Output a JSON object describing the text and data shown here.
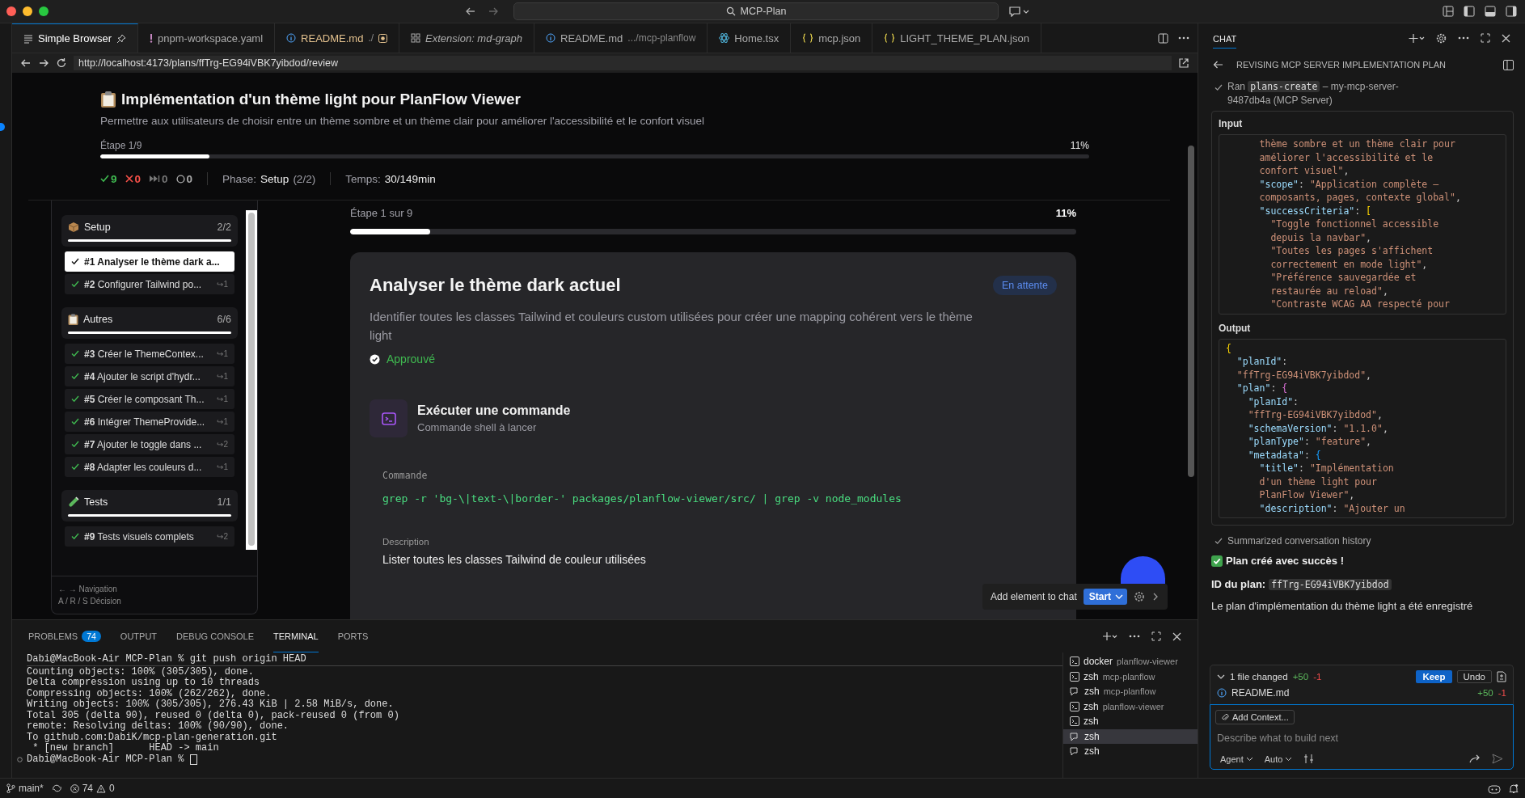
{
  "window": {
    "search": "MCP-Plan"
  },
  "editor_tabs": [
    {
      "label": "Simple Browser",
      "kind": "browser",
      "selected": true,
      "modified": false,
      "preview": false,
      "pinned": true
    },
    {
      "label": "pnpm-workspace.yaml",
      "kind": "yaml",
      "selected": false,
      "modified": false,
      "preview": false,
      "pinned": false
    },
    {
      "label": "README.md",
      "detail": "./",
      "kind": "info",
      "selected": false,
      "modified": true,
      "preview": false,
      "pinned": false
    },
    {
      "label": "Extension: md-graph",
      "kind": "extension",
      "selected": false,
      "modified": false,
      "preview": true,
      "pinned": false
    },
    {
      "label": "README.md",
      "detail": ".../mcp-planflow",
      "kind": "info",
      "selected": false,
      "modified": false,
      "preview": false,
      "pinned": false
    },
    {
      "label": "Home.tsx",
      "kind": "react",
      "selected": false,
      "modified": false,
      "preview": false,
      "pinned": false
    },
    {
      "label": "mcp.json",
      "kind": "json",
      "selected": false,
      "modified": false,
      "preview": false,
      "pinned": false
    },
    {
      "label": "LIGHT_THEME_PLAN.json",
      "kind": "json",
      "selected": false,
      "modified": false,
      "preview": false,
      "pinned": false
    }
  ],
  "browser": {
    "url": "http://localhost:4173/plans/ffTrg-EG94iVBK7yibdod/review"
  },
  "plan": {
    "title": "Implémentation d'un thème light pour PlanFlow Viewer",
    "description": "Permettre aux utilisateurs de choisir entre un thème sombre et un thème clair pour améliorer l'accessibilité et le confort visuel",
    "step_label": "Étape 1/9",
    "percent": "11%",
    "level": 0.11,
    "stats": [
      {
        "kind": "done",
        "text": "9"
      },
      {
        "kind": "failed",
        "text": "0"
      },
      {
        "kind": "skipped",
        "text": "0"
      },
      {
        "kind": "pending",
        "text": "0"
      }
    ],
    "phase_label": "Phase:",
    "phase": "Setup",
    "phase_count": "(2/2)",
    "time_label": "Temps:",
    "time": "30/149min"
  },
  "sidebar": {
    "groups": [
      {
        "kind": "package",
        "title": "Setup",
        "count": "2/2",
        "level": 1,
        "steps": [
          {
            "label": "**#1** Analyser le thème dark a...",
            "selected": true,
            "done": true
          },
          {
            "label": "**#2** Configurer Tailwind po...",
            "deps": "↪1",
            "selected": false,
            "done": true
          }
        ]
      },
      {
        "kind": "clipboard",
        "title": "Autres",
        "count": "6/6",
        "level": 1,
        "steps": [
          {
            "label": "**#3** Créer le ThemeContex...",
            "deps": "↪1",
            "selected": false,
            "done": true
          },
          {
            "label": "**#4** Ajouter le script d'hydr...",
            "deps": "↪1",
            "selected": false,
            "done": true
          },
          {
            "label": "**#5** Créer le composant Th...",
            "deps": "↪1",
            "selected": false,
            "done": true
          },
          {
            "label": "**#6** Intégrer ThemeProvide...",
            "deps": "↪1",
            "selected": false,
            "done": true
          },
          {
            "label": "**#7** Ajouter le toggle dans ...",
            "deps": "↪2",
            "selected": false,
            "done": true
          },
          {
            "label": "**#8** Adapter les couleurs d...",
            "deps": "↪1",
            "selected": false,
            "done": true
          }
        ]
      },
      {
        "kind": "test",
        "title": "Tests",
        "count": "1/1",
        "level": 1,
        "steps": [
          {
            "label": "**#9** Tests visuels complets",
            "deps": "↪2",
            "selected": false,
            "done": true
          }
        ]
      }
    ],
    "footer": [
      "← → Navigation",
      "A / R / S Décision"
    ]
  },
  "step": {
    "label": "Étape 1 sur 9",
    "percent": "11%",
    "level": 0.11,
    "title": "Analyser le thème dark actuel",
    "badge": "En attente",
    "description": "Identifier toutes les classes Tailwind et couleurs custom utilisées pour créer une mapping cohérent vers le thème light",
    "status": {
      "text": "Approuvé",
      "approved": true
    },
    "action": {
      "title": "Exécuter une commande",
      "subtitle": "Commande shell à lancer"
    },
    "fields": [
      {
        "kind": "code",
        "label": "Commande",
        "value": "grep -r 'bg-\\|text-\\|border-' packages/planflow-viewer/src/ | grep -v node_modules"
      },
      {
        "kind": "text",
        "label": "Description",
        "value": "Lister toutes les classes Tailwind de couleur utilisées"
      }
    ]
  },
  "element_picker": {
    "label": "Add element to chat",
    "button": "Start"
  },
  "panel": {
    "tabs": [
      {
        "label": "PROBLEMS",
        "badge": "74",
        "selected": false
      },
      {
        "label": "OUTPUT",
        "selected": false
      },
      {
        "label": "DEBUG CONSOLE",
        "selected": false
      },
      {
        "label": "TERMINAL",
        "selected": true
      },
      {
        "label": "PORTS",
        "selected": false
      }
    ],
    "terminal_lines": [
      "Dabi@MacBook-Air MCP-Plan % git push origin HEAD",
      "Counting objects: 100% (305/305), done.",
      "Delta compression using up to 10 threads",
      "Compressing objects: 100% (262/262), done.",
      "Writing objects: 100% (305/305), 276.43 KiB | 2.58 MiB/s, done.",
      "Total 305 (delta 90), reused 0 (delta 0), pack-reused 0 (from 0)",
      "remote: Resolving deltas: 100% (90/90), done.",
      "To github.com:DabiK/mcp-plan-generation.git",
      " * [new branch]      HEAD -> main",
      "Dabi@MacBook-Air MCP-Plan % "
    ],
    "terminals": [
      {
        "name": "docker",
        "detail": "planflow-viewer",
        "kind": "shell",
        "selected": false
      },
      {
        "name": "zsh",
        "detail": "mcp-planflow",
        "kind": "shell",
        "selected": false
      },
      {
        "name": "zsh",
        "detail": "mcp-planflow",
        "kind": "agent",
        "selected": false
      },
      {
        "name": "zsh",
        "detail": "planflow-viewer",
        "kind": "shell",
        "selected": false
      },
      {
        "name": "zsh",
        "kind": "shell",
        "selected": false
      },
      {
        "name": "zsh",
        "kind": "agent",
        "selected": true
      },
      {
        "name": "zsh",
        "kind": "agent",
        "selected": false
      }
    ]
  },
  "status_bar": {
    "branch": "main*",
    "errors": "74",
    "warnings": "0"
  },
  "chat": {
    "tab": "CHAT",
    "title": "REVISING MCP SERVER IMPLEMENTATION PLAN",
    "tool_run": {
      "prefix": "Ran",
      "tool": "plans-create",
      "suffix": "– my-mcp-server-9487db4a (MCP Server)"
    },
    "input_label": "Input",
    "input_lines": [
      [
        {
          "kind": "str",
          "t": "      thème sombre et un thème clair pour"
        }
      ],
      [
        {
          "kind": "str",
          "t": "      améliorer l'accessibilité et le"
        }
      ],
      [
        {
          "kind": "str",
          "t": "      confort visuel\""
        },
        {
          "kind": "punc",
          "t": ","
        }
      ],
      [
        {
          "kind": "key",
          "t": "      \"scope\""
        },
        {
          "kind": "punc",
          "t": ": "
        },
        {
          "kind": "str",
          "t": "\"Application complète –"
        }
      ],
      [
        {
          "kind": "str",
          "t": "      composants, pages, contexte global\""
        },
        {
          "kind": "punc",
          "t": ","
        }
      ],
      [
        {
          "kind": "key",
          "t": "      \"successCriteria\""
        },
        {
          "kind": "punc",
          "t": ": "
        },
        {
          "kind": "b1",
          "t": "["
        }
      ],
      [
        {
          "kind": "str",
          "t": "        \"Toggle fonctionnel accessible"
        }
      ],
      [
        {
          "kind": "str",
          "t": "        depuis la navbar\""
        },
        {
          "kind": "punc",
          "t": ","
        }
      ],
      [
        {
          "kind": "str",
          "t": "        \"Toutes les pages s'affichent"
        }
      ],
      [
        {
          "kind": "str",
          "t": "        correctement en mode light\""
        },
        {
          "kind": "punc",
          "t": ","
        }
      ],
      [
        {
          "kind": "str",
          "t": "        \"Préférence sauvegardée et"
        }
      ],
      [
        {
          "kind": "str",
          "t": "        restaurée au reload\""
        },
        {
          "kind": "punc",
          "t": ","
        }
      ],
      [
        {
          "kind": "str",
          "t": "        \"Contraste WCAG AA respecté pour"
        }
      ]
    ],
    "output_label": "Output",
    "output_lines": [
      [
        {
          "kind": "b1",
          "t": "{"
        }
      ],
      [
        {
          "kind": "key",
          "t": "  \"planId\""
        },
        {
          "kind": "punc",
          "t": ":"
        }
      ],
      [
        {
          "kind": "str",
          "t": "  \"ffTrg-EG94iVBK7yibdod\""
        },
        {
          "kind": "punc",
          "t": ","
        }
      ],
      [
        {
          "kind": "key",
          "t": "  \"plan\""
        },
        {
          "kind": "punc",
          "t": ": "
        },
        {
          "kind": "b2",
          "t": "{"
        }
      ],
      [
        {
          "kind": "key",
          "t": "    \"planId\""
        },
        {
          "kind": "punc",
          "t": ":"
        }
      ],
      [
        {
          "kind": "str",
          "t": "    \"ffTrg-EG94iVBK7yibdod\""
        },
        {
          "kind": "punc",
          "t": ","
        }
      ],
      [
        {
          "kind": "key",
          "t": "    \"schemaVersion\""
        },
        {
          "kind": "punc",
          "t": ": "
        },
        {
          "kind": "str",
          "t": "\"1.1.0\""
        },
        {
          "kind": "punc",
          "t": ","
        }
      ],
      [
        {
          "kind": "key",
          "t": "    \"planType\""
        },
        {
          "kind": "punc",
          "t": ": "
        },
        {
          "kind": "str",
          "t": "\"feature\""
        },
        {
          "kind": "punc",
          "t": ","
        }
      ],
      [
        {
          "kind": "key",
          "t": "    \"metadata\""
        },
        {
          "kind": "punc",
          "t": ": "
        },
        {
          "kind": "b3",
          "t": "{"
        }
      ],
      [
        {
          "kind": "key",
          "t": "      \"title\""
        },
        {
          "kind": "punc",
          "t": ": "
        },
        {
          "kind": "str",
          "t": "\"Implémentation"
        }
      ],
      [
        {
          "kind": "str",
          "t": "      d'un thème light pour"
        }
      ],
      [
        {
          "kind": "str",
          "t": "      PlanFlow Viewer\""
        },
        {
          "kind": "punc",
          "t": ","
        }
      ],
      [
        {
          "kind": "key",
          "t": "      \"description\""
        },
        {
          "kind": "punc",
          "t": ": "
        },
        {
          "kind": "str",
          "t": "\"Ajouter un"
        }
      ]
    ],
    "summary": "Summarized conversation history",
    "success": "Plan créé avec succès !",
    "plan_id_label": "ID du plan:",
    "plan_id": "ffTrg-EG94iVBK7yibdod",
    "message": "Le plan d'implémentation du thème light a été enregistré",
    "changes": {
      "summary": "1 file changed",
      "added": "+50",
      "removed": "-1",
      "keep": "Keep",
      "undo": "Undo",
      "files": [
        {
          "name": "README.md",
          "added": "+50",
          "removed": "-1"
        }
      ]
    },
    "composer": {
      "context": "Add Context...",
      "placeholder": "Describe what to build next",
      "mode": "Agent",
      "model": "Auto"
    }
  }
}
